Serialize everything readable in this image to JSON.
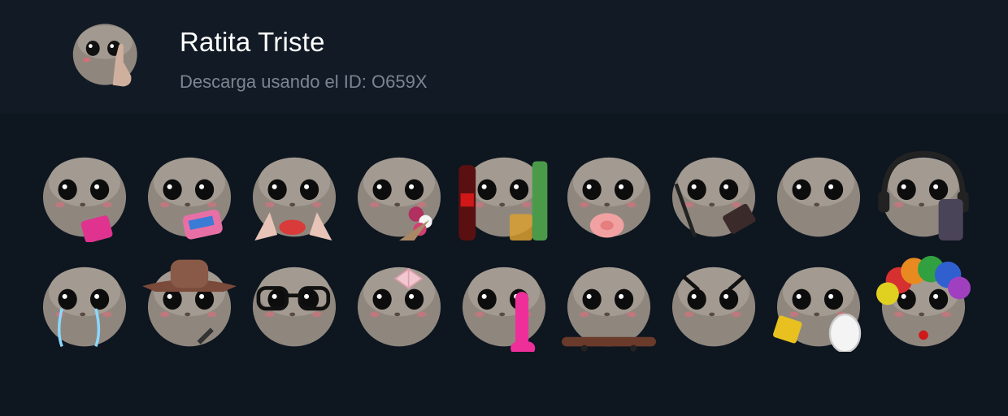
{
  "pack": {
    "title": "Ratita Triste",
    "subtitle": "Descarga usando el ID: O659X",
    "thumbnail_icon": "sad-hamster-middle-finger-icon"
  },
  "stickers": [
    {
      "name": "sad-hamster-condom-sticker"
    },
    {
      "name": "sad-hamster-pad-sticker"
    },
    {
      "name": "sad-hamster-lips-nails-sticker"
    },
    {
      "name": "sad-hamster-flowers-sticker"
    },
    {
      "name": "sad-hamster-drinks-sticker"
    },
    {
      "name": "sad-hamster-pacifier-sticker"
    },
    {
      "name": "sad-hamster-makeup-sticker"
    },
    {
      "name": "sad-hamster-plain-sticker"
    },
    {
      "name": "sad-hamster-headphones-phone-sticker"
    },
    {
      "name": "sad-hamster-crying-sticker"
    },
    {
      "name": "sad-hamster-cowboy-sticker"
    },
    {
      "name": "sad-hamster-glasses-sticker"
    },
    {
      "name": "sad-hamster-bow-sticker"
    },
    {
      "name": "sad-hamster-pink-toy-sticker"
    },
    {
      "name": "sad-hamster-skateboard-sticker"
    },
    {
      "name": "sad-hamster-angry-sticker"
    },
    {
      "name": "sad-hamster-sponge-plate-sticker"
    },
    {
      "name": "sad-hamster-clown-sticker"
    }
  ],
  "colors": {
    "background": "#0e1620",
    "header": "#121b25",
    "title": "#ffffff",
    "subtitle": "#7b8591"
  }
}
